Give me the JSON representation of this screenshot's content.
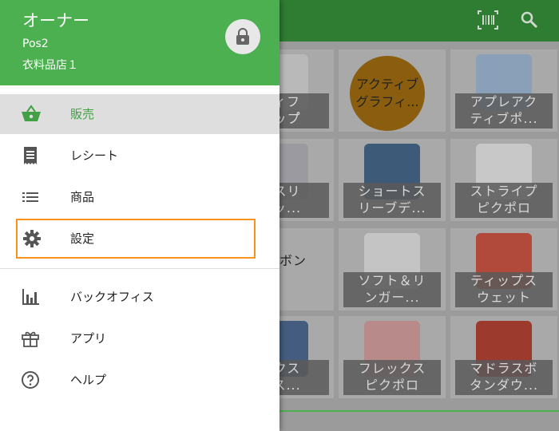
{
  "drawer": {
    "owner_name": "オーナー",
    "pos_name": "Pos2",
    "store_name": "衣料品店１",
    "items": [
      {
        "label": "販売",
        "icon": "basket-icon",
        "active": true
      },
      {
        "label": "レシート",
        "icon": "receipt-icon"
      },
      {
        "label": "商品",
        "icon": "list-icon"
      },
      {
        "label": "設定",
        "icon": "gear-icon",
        "highlighted": true
      },
      {
        "label": "バックオフィス",
        "icon": "bar-chart-icon"
      },
      {
        "label": "アプリ",
        "icon": "gift-icon"
      },
      {
        "label": "ヘルプ",
        "icon": "help-icon"
      }
    ]
  },
  "background": {
    "tiles": [
      {
        "label": "ティフ\nラップ゚",
        "shirt_color": "#b9b9b9"
      },
      {
        "label": "アクティブ\nグラフィ...",
        "shirt_color": "#8a5d0f",
        "badge": true
      },
      {
        "label": "アプレアク\nティブポ...",
        "shirt_color": "#8aa0b8"
      },
      {
        "label": "ドスリ\nマッ...",
        "shirt_color": "#9a9aa0"
      },
      {
        "label": "ショートス\nリーブデ...",
        "shirt_color": "#3d5a78"
      },
      {
        "label": "ストライプ\nピクポロ",
        "shirt_color": "#c8c8c8"
      },
      {
        "label": "ボン",
        "shirt_color": "#a9a9a9"
      },
      {
        "label": "ソフト＆リ\nンガー...",
        "shirt_color": "#c4c4c4"
      },
      {
        "label": "ティップス\nウェット",
        "shirt_color": "#b14a3a"
      },
      {
        "label": "ックス\nース...",
        "shirt_color": "#445c80"
      },
      {
        "label": "フレックス\nピクポロ",
        "shirt_color": "#b98a8a"
      },
      {
        "label": "マドラスボ\nタンダウ...",
        "shirt_color": "#9c3a2e"
      }
    ]
  },
  "colors": {
    "header_green": "#4caf50",
    "accent_green": "#43a047",
    "highlight_orange": "#f7931e"
  }
}
